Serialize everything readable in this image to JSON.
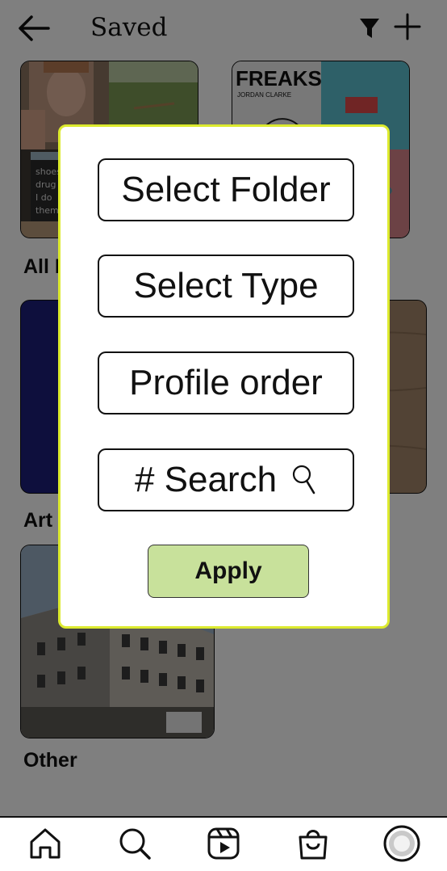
{
  "header": {
    "title": "Saved"
  },
  "collections": [
    {
      "label": "All Posts"
    },
    {
      "label": "Art"
    },
    {
      "label": "Other"
    }
  ],
  "modal": {
    "options": [
      {
        "label": "Select Folder"
      },
      {
        "label": "Select Type"
      },
      {
        "label": "Profile order"
      },
      {
        "label": "# Search"
      }
    ],
    "apply_label": "Apply"
  },
  "thumbnail_text": {
    "freaks_title": "FREAKS",
    "freaks_author": "JORDAN CLARKE"
  },
  "icons": {
    "back": "arrow-left-icon",
    "filter": "filter-icon",
    "add": "plus-icon",
    "home": "home-icon",
    "search": "search-icon",
    "reels": "reels-icon",
    "shop": "shopping-bag-icon",
    "profile": "profile-avatar-icon",
    "search_field": "magnifier-icon"
  },
  "colors": {
    "modal_border": "#dcea2e",
    "apply_background": "#c8e19b",
    "art_collection": "#1c1f7a"
  }
}
